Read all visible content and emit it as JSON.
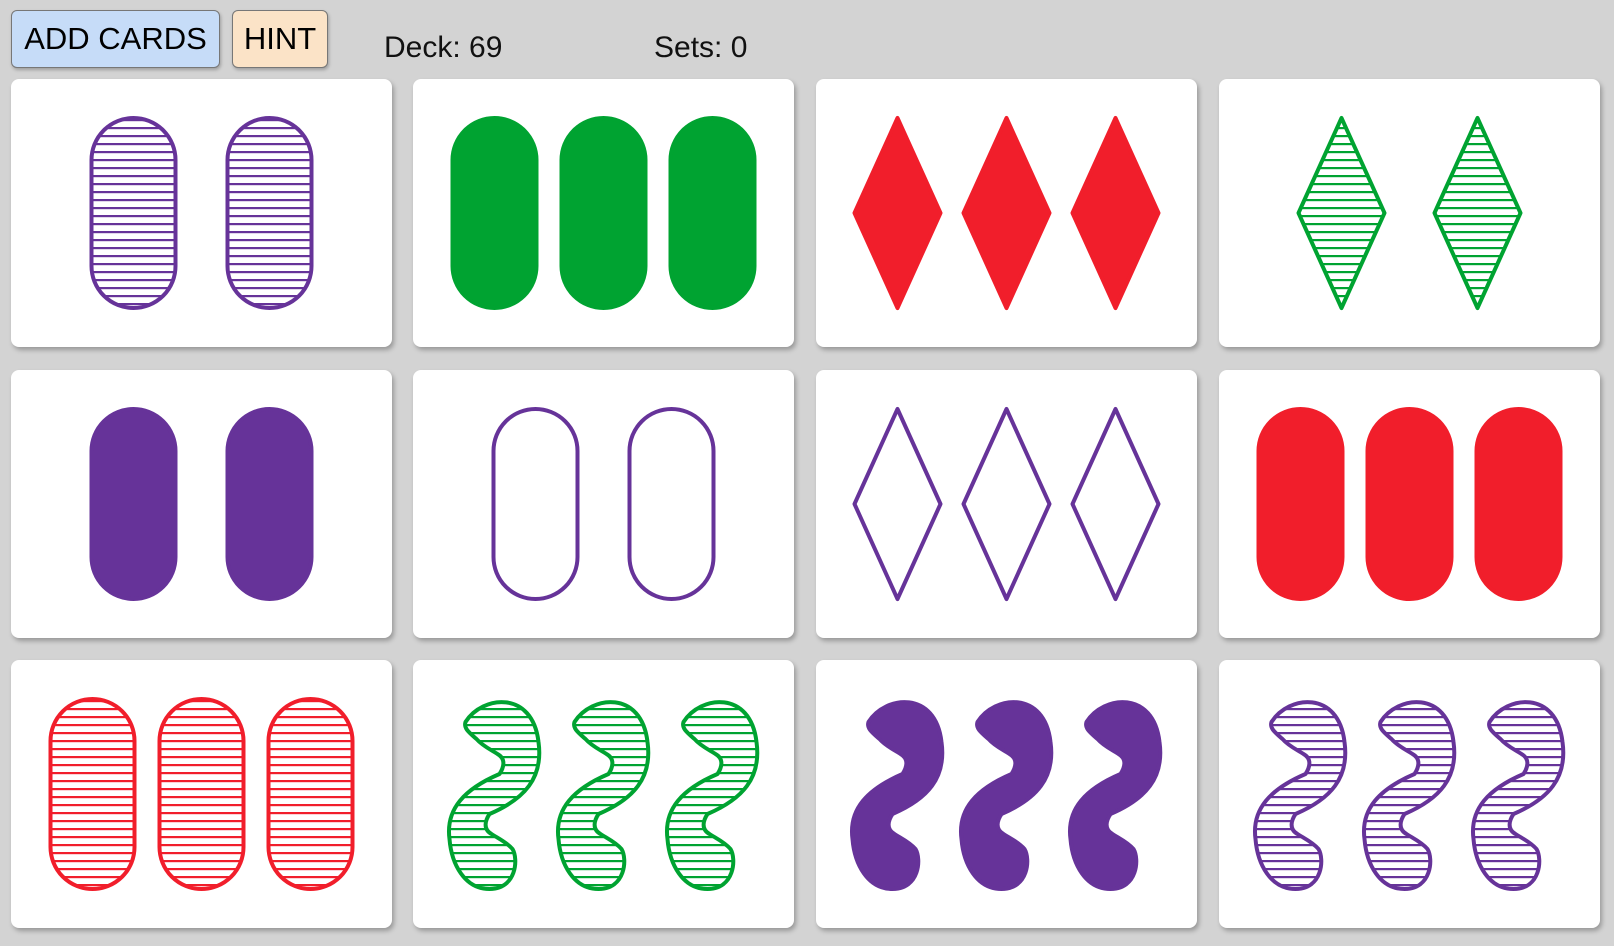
{
  "toolbar": {
    "add_cards_label": "ADD CARDS",
    "hint_label": "HINT",
    "deck_text": "Deck: 69",
    "sets_text": "Sets: 0"
  },
  "game": {
    "deck_remaining": 69,
    "sets_found": 0
  },
  "colors": {
    "purple": "#663399",
    "green": "#00a331",
    "red": "#f11e2b",
    "add_button_bg": "#c6dcf8",
    "hint_button_bg": "#fbe3c7",
    "background": "#d3d3d3",
    "card": "#ffffff"
  },
  "cards": [
    {
      "count": 2,
      "shape": "oval",
      "color": "purple",
      "fill": "striped"
    },
    {
      "count": 3,
      "shape": "oval",
      "color": "green",
      "fill": "solid"
    },
    {
      "count": 3,
      "shape": "diamond",
      "color": "red",
      "fill": "solid"
    },
    {
      "count": 2,
      "shape": "diamond",
      "color": "green",
      "fill": "striped"
    },
    {
      "count": 2,
      "shape": "oval",
      "color": "purple",
      "fill": "solid"
    },
    {
      "count": 2,
      "shape": "oval",
      "color": "purple",
      "fill": "open"
    },
    {
      "count": 3,
      "shape": "diamond",
      "color": "purple",
      "fill": "open"
    },
    {
      "count": 3,
      "shape": "oval",
      "color": "red",
      "fill": "solid"
    },
    {
      "count": 3,
      "shape": "oval",
      "color": "red",
      "fill": "striped"
    },
    {
      "count": 3,
      "shape": "squiggle",
      "color": "green",
      "fill": "striped"
    },
    {
      "count": 3,
      "shape": "squiggle",
      "color": "purple",
      "fill": "solid"
    },
    {
      "count": 3,
      "shape": "squiggle",
      "color": "purple",
      "fill": "striped"
    }
  ]
}
